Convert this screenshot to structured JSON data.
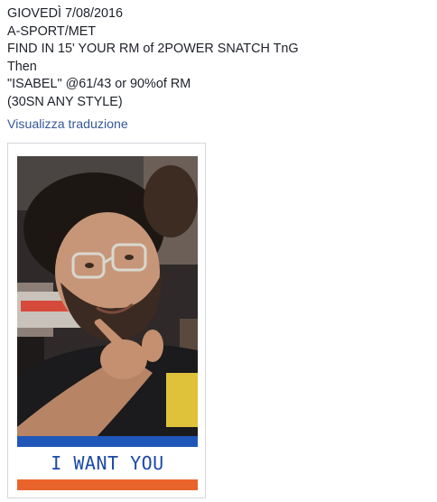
{
  "post": {
    "lines": [
      "GIOVEDÌ 7/08/2016",
      "A-SPORT/MET",
      "FIND IN 15' YOUR RM of 2POWER SNATCH TnG",
      "Then",
      "\"ISABEL\" @61/43 or 90%of RM",
      "(30SN ANY STYLE)"
    ],
    "translate_link": "Visualizza traduzione"
  },
  "photo": {
    "subject": "man-pointing-photo",
    "banner_text": "I WANT YOU",
    "colors": {
      "banner_blue": "#1f57b8",
      "banner_orange": "#e9642c",
      "banner_text": "#1c4aa6",
      "link": "#365899"
    }
  }
}
